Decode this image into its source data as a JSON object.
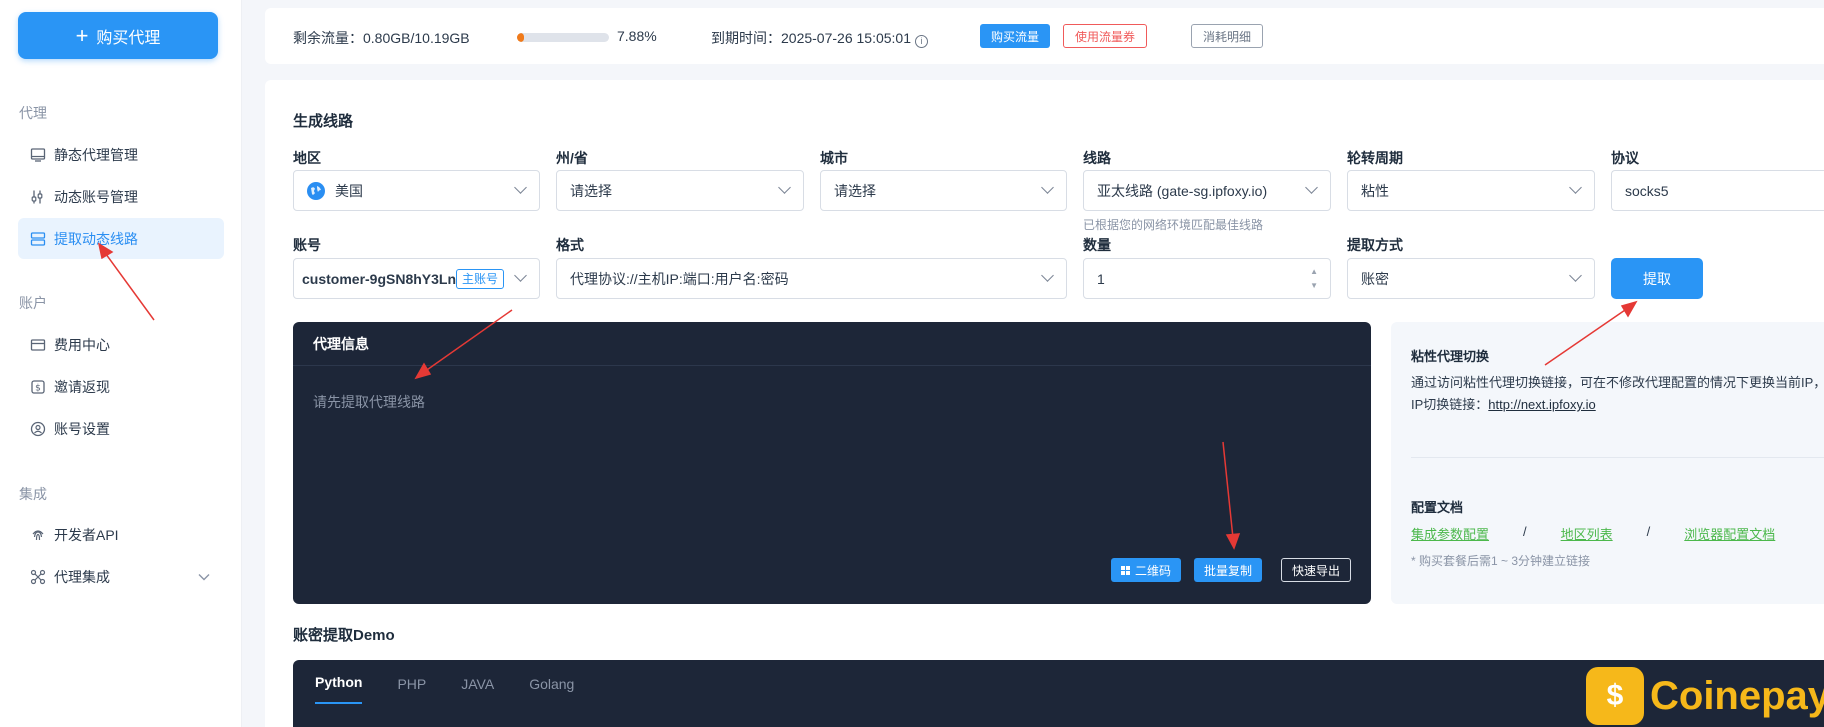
{
  "sidebar": {
    "buy_label": "购买代理",
    "sections": {
      "proxy": "代理",
      "account": "账户",
      "integration": "集成"
    },
    "items": [
      {
        "label": "静态代理管理",
        "icon": "monitor-icon"
      },
      {
        "label": "动态账号管理",
        "icon": "sliders-icon"
      },
      {
        "label": "提取动态线路",
        "icon": "server-icon"
      },
      {
        "label": "费用中心",
        "icon": "card-icon"
      },
      {
        "label": "邀请返现",
        "icon": "dollar-icon"
      },
      {
        "label": "账号设置",
        "icon": "user-icon"
      },
      {
        "label": "开发者API",
        "icon": "fingerprint-icon"
      },
      {
        "label": "代理集成",
        "icon": "integration-icon"
      }
    ]
  },
  "status": {
    "remaining_label": "剩余流量：",
    "remaining_value": "0.80GB/10.19GB",
    "progress_percent": 7.88,
    "progress_text": "7.88%",
    "expiry_label": "到期时间：",
    "expiry_value": "2025-07-26 15:05:01",
    "buy_traffic": "购买流量",
    "use_coupon": "使用流量券",
    "usage_detail": "消耗明细"
  },
  "form": {
    "title": "生成线路",
    "region_label": "地区",
    "region_value": "美国",
    "state_label": "州/省",
    "state_value": "请选择",
    "city_label": "城市",
    "city_value": "请选择",
    "route_label": "线路",
    "route_value": "亚太线路 (gate-sg.ipfoxy.io)",
    "route_hint": "已根据您的网络环境匹配最佳线路",
    "rotation_label": "轮转周期",
    "rotation_value": "粘性",
    "protocol_label": "协议",
    "protocol_value": "socks5",
    "account_label": "账号",
    "account_value": "customer-9gSN8hY3Ln",
    "account_badge": "主账号",
    "format_label": "格式",
    "format_value": "代理协议://主机IP:端口:用户名:密码",
    "quantity_label": "数量",
    "quantity_value": "1",
    "method_label": "提取方式",
    "method_value": "账密",
    "extract_button": "提取"
  },
  "proxy_panel": {
    "title": "代理信息",
    "empty_text": "请先提取代理线路",
    "qr_button": "二维码",
    "copy_button": "批量复制",
    "export_button": "快速导出"
  },
  "info": {
    "sticky_title": "粘性代理切换",
    "sticky_desc": "通过访问粘性代理切换链接，可在不修改代理配置的情况下更换当前IP，",
    "ip_switch_label": "IP切换链接：",
    "ip_switch_link": "http://next.ipfoxy.io",
    "doc_title": "配置文档",
    "doc_links": [
      "集成参数配置",
      "地区列表",
      "浏览器配置文档"
    ],
    "separator": "/",
    "note": "* 购买套餐后需1 ~ 3分钟建立链接"
  },
  "demo": {
    "title": "账密提取Demo",
    "tabs": [
      "Python",
      "PHP",
      "JAVA",
      "Golang"
    ]
  },
  "watermark": {
    "logo_symbol": "$",
    "text": "Coinepay"
  },
  "colors": {
    "accent": "#2a95f5",
    "dark_panel": "#1d2638",
    "progress": "#f07a1a",
    "danger": "#f05a5a",
    "link_green": "#4cb84c",
    "arrow": "#e53935"
  }
}
